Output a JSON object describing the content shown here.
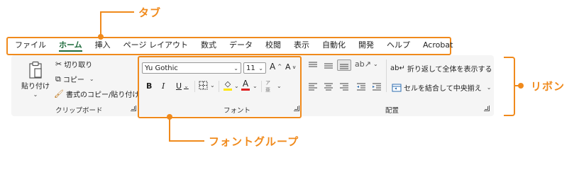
{
  "callouts": {
    "tab_label": "タブ",
    "ribbon_label": "リボン",
    "font_group_label": "フォントグループ"
  },
  "tabs": [
    {
      "label": "ファイル"
    },
    {
      "label": "ホーム",
      "active": true
    },
    {
      "label": "挿入"
    },
    {
      "label": "ページ レイアウト"
    },
    {
      "label": "数式"
    },
    {
      "label": "データ"
    },
    {
      "label": "校閲"
    },
    {
      "label": "表示"
    },
    {
      "label": "自動化"
    },
    {
      "label": "開発"
    },
    {
      "label": "ヘルプ"
    },
    {
      "label": "Acrobat"
    }
  ],
  "clipboard": {
    "paste_label": "貼り付け",
    "cut_label": "切り取り",
    "copy_label": "コピー",
    "format_painter_label": "書式のコピー/貼り付け",
    "group_label": "クリップボード"
  },
  "font": {
    "font_name": "Yu Gothic",
    "font_size": "11",
    "bold": "B",
    "italic": "I",
    "underline": "U",
    "group_label": "フォント"
  },
  "alignment": {
    "wrap_text_label": "折り返して全体を表示する",
    "merge_center_label": "セルを結合して中央揃え",
    "group_label": "配置"
  },
  "colors": {
    "accent": "#f08a1c",
    "active_tab": "#1e6b3b",
    "ribbon_bg": "#f5f5f5",
    "font_color_bar": "#e02020",
    "highlight_bar": "#ffe600"
  }
}
